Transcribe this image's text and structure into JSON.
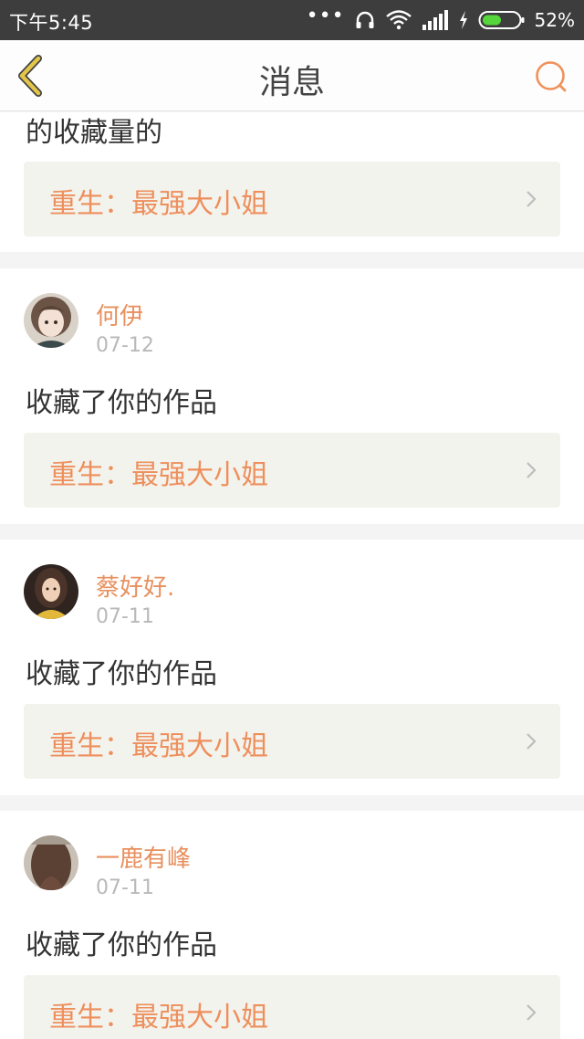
{
  "status_bar": {
    "time": "下午5:45",
    "dots": "•••",
    "battery_percent": "52%",
    "icons": [
      "headphones-icon",
      "wifi-icon",
      "signal-icon",
      "charging-icon",
      "battery-icon"
    ],
    "battery_level": 0.52
  },
  "nav": {
    "title": "消息",
    "back_icon": "chevron-left-icon",
    "search_icon": "search-icon"
  },
  "colors": {
    "accent": "#ee8f5c",
    "back_icon": "#e3c54a",
    "card_bg": "#ffffff",
    "work_bg": "#f3f3ee",
    "separator": "#f4f4f4"
  },
  "messages": [
    {
      "action_text": "的收藏量的",
      "work_title": "重生：最强大小姐"
    },
    {
      "user_name": "何伊",
      "date": "07-12",
      "action_text": "收藏了你的作品",
      "work_title": "重生：最强大小姐"
    },
    {
      "user_name": "蔡好好.",
      "date": "07-11",
      "action_text": "收藏了你的作品",
      "work_title": "重生：最强大小姐"
    },
    {
      "user_name": "一鹿有峰",
      "date": "07-11",
      "action_text": "收藏了你的作品",
      "work_title": "重生：最强大小姐"
    }
  ]
}
